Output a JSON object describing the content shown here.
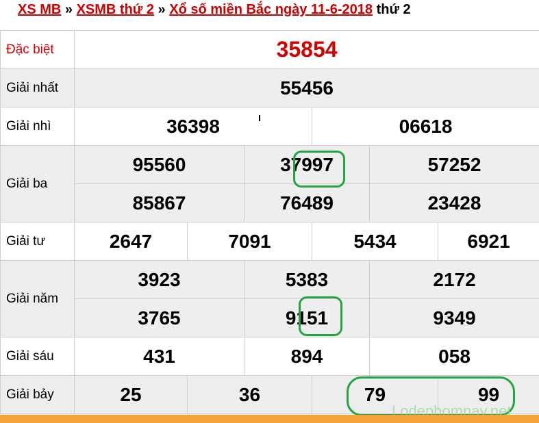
{
  "header": {
    "link1": "XS MB",
    "sep1": " » ",
    "link2": "XSMB thứ 2",
    "sep2": " » ",
    "link3": "Xổ số miền Bắc ngày 11-6-2018",
    "suffix": " thứ 2"
  },
  "prizes": {
    "special": {
      "label": "Đặc biệt",
      "numbers": [
        "35854"
      ]
    },
    "first": {
      "label": "Giải nhất",
      "numbers": [
        "55456"
      ]
    },
    "second": {
      "label": "Giải nhì",
      "numbers": [
        "36398",
        "06618"
      ]
    },
    "third": {
      "label": "Giải ba",
      "numbers": [
        "95560",
        "37997",
        "57252",
        "85867",
        "76489",
        "23428"
      ]
    },
    "fourth": {
      "label": "Giải tư",
      "numbers": [
        "2647",
        "7091",
        "5434",
        "6921"
      ]
    },
    "fifth": {
      "label": "Giải năm",
      "numbers": [
        "3923",
        "5383",
        "2172",
        "3765",
        "9151",
        "9349"
      ]
    },
    "sixth": {
      "label": "Giải sáu",
      "numbers": [
        "431",
        "894",
        "058"
      ]
    },
    "seventh": {
      "label": "Giải bảy",
      "numbers": [
        "25",
        "36",
        "79",
        "99"
      ]
    }
  },
  "watermark": "Lodephomnay.net",
  "colors": {
    "special": "#d40000",
    "link": "#cc0000",
    "highlight": "#22a540",
    "footer": "#f3a33a"
  }
}
